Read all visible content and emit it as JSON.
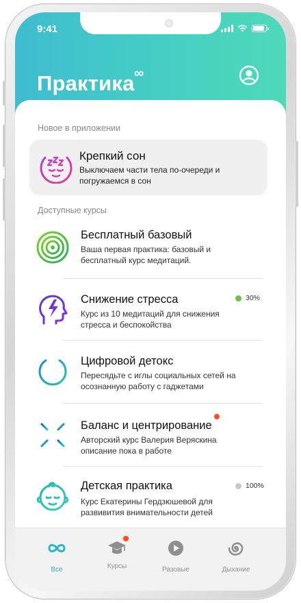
{
  "status_bar": {
    "time": "9:41"
  },
  "header": {
    "title": "Практика",
    "title_symbol": "∞"
  },
  "colors": {
    "accent": "#2ab7c6",
    "header_gradient": [
      "#3fbcd0",
      "#4ed9b8"
    ],
    "progress_green": "#6cc24a",
    "progress_gray": "#c8c8c8",
    "notification_red": "#ff4d1f"
  },
  "sections": {
    "new_label": "Новое в приложении",
    "available_label": "Доступные курсы"
  },
  "featured": {
    "icon": "sleep-face-icon",
    "title": "Крепкий сон",
    "description": "Выключаем части тела по-очереди и погружаемся в сон"
  },
  "courses": [
    {
      "icon": "target-rings-icon",
      "title": "Бесплатный базовый",
      "description": "Ваша первая практика: базовый и бесплатный курс медитаций."
    },
    {
      "icon": "head-bolt-icon",
      "title": "Снижение стресса",
      "description": "Курс из 10 медитаций для снижения стресса и беспокойства",
      "progress": "30%"
    },
    {
      "icon": "power-icon",
      "title": "Цифровой детокс",
      "description": "Пересядьте с иглы социальных сетей на осознанную работу с гаджетами"
    },
    {
      "icon": "burst-icon",
      "title": "Баланс и центрирование",
      "description": "Авторский курс Валерия Веряскина описание пока в работе",
      "has_new": true
    },
    {
      "icon": "child-face-icon",
      "title": "Детская практика",
      "description": "Курс Екатерины Гердзюшевой для развивития внимательности детей",
      "progress": "100%"
    }
  ],
  "tabs": [
    {
      "icon": "infinity-icon",
      "label": "Все",
      "active": true
    },
    {
      "icon": "graduation-cap-icon",
      "label": "Курсы",
      "has_new": true
    },
    {
      "icon": "play-icon",
      "label": "Разовые"
    },
    {
      "icon": "spiral-icon",
      "label": "Дыхание"
    }
  ]
}
